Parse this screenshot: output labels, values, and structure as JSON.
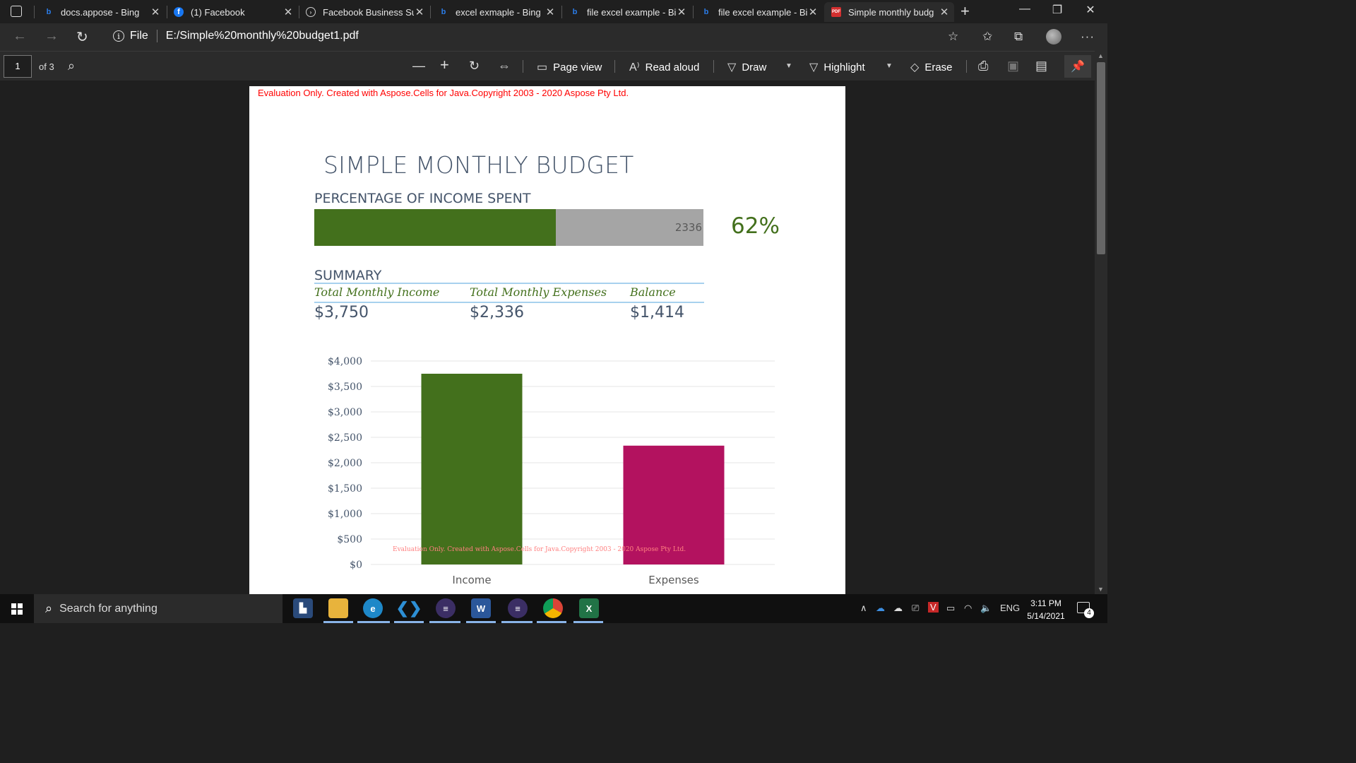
{
  "browser": {
    "tabs": [
      {
        "title": "docs.appose - Bing",
        "favicon": "bing-icon"
      },
      {
        "title": "(1) Facebook",
        "favicon": "facebook-icon"
      },
      {
        "title": "Facebook Business Su",
        "favicon": "facebook-business-icon"
      },
      {
        "title": "excel exmaple - Bing",
        "favicon": "bing-icon"
      },
      {
        "title": "file excel example - Bi",
        "favicon": "bing-icon"
      },
      {
        "title": "file excel example - Bi",
        "favicon": "bing-icon"
      },
      {
        "title": "Simple monthly budg",
        "favicon": "pdf-icon",
        "active": true
      }
    ],
    "address": {
      "scheme_label": "File",
      "url": "E:/Simple%20monthly%20budget1.pdf"
    }
  },
  "pdf_toolbar": {
    "page_current": "1",
    "page_total": "of 3",
    "page_view_label": "Page view",
    "read_aloud_label": "Read aloud",
    "draw_label": "Draw",
    "highlight_label": "Highlight",
    "erase_label": "Erase"
  },
  "document": {
    "eval_notice": "Evaluation Only. Created with Aspose.Cells for Java.Copyright 2003 - 2020 Aspose Pty Ltd.",
    "title": "SIMPLE MONTHLY BUDGET",
    "progress": {
      "label": "PERCENTAGE OF INCOME SPENT",
      "bar_value_text": "2336",
      "fraction": 0.62,
      "percent_text": "62%"
    },
    "summary": {
      "title": "SUMMARY",
      "headers": [
        "Total Monthly Income",
        "Total Monthly Expenses",
        "Balance"
      ],
      "values": [
        "$3,750",
        "$2,336",
        "$1,414"
      ]
    },
    "chart_watermark": "Evaluation Only. Created with Aspose.Cells for Java.Copyright 2003 - 2020 Aspose Pty Ltd."
  },
  "chart_data": {
    "type": "bar",
    "categories": [
      "Income",
      "Expenses"
    ],
    "values": [
      3750,
      2336
    ],
    "colors": [
      "#43701c",
      "#b3125f"
    ],
    "y_ticks": [
      "$0",
      "$500",
      "$1,000",
      "$1,500",
      "$2,000",
      "$2,500",
      "$3,000",
      "$3,500",
      "$4,000"
    ],
    "ylim": [
      0,
      4000
    ],
    "grid": true,
    "title": "",
    "xlabel": "",
    "ylabel": ""
  },
  "taskbar": {
    "search_placeholder": "Search for anything",
    "language": "ENG",
    "time": "3:11 PM",
    "date": "5/14/2021",
    "notification_count": "4"
  }
}
